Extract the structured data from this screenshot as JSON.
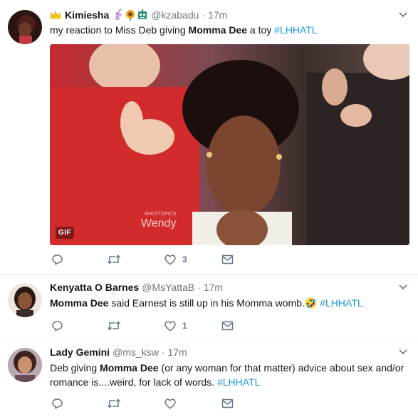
{
  "tweets": [
    {
      "fullname": "Kimiesha",
      "handle": "@kzabadu",
      "dot": "·",
      "time": "17m",
      "text_parts": [
        "my reaction to Miss Deb giving ",
        "Momma Dee",
        " a toy  ",
        "#LHHATL"
      ],
      "media_badge": "GIF",
      "media_watermark_tag": "#HOTTOPICS",
      "media_watermark": "Wendy",
      "reply_count": "",
      "retweet_count": "",
      "like_count": "3"
    },
    {
      "fullname": "Kenyatta O Barnes",
      "handle": "@MsYattaB",
      "dot": "·",
      "time": "17m",
      "text_parts": [
        "Momma Dee",
        " said Earnest  is still up in his Momma womb.",
        "🤣",
        " #LHHATL"
      ],
      "reply_count": "",
      "retweet_count": "",
      "like_count": "1"
    },
    {
      "fullname": "Lady Gemini",
      "handle": "@ms_ksw",
      "dot": "·",
      "time": "17m",
      "text_parts": [
        "Deb giving ",
        "Momma Dee",
        " (or any woman for that matter) advice about sex and/or romance is....weird, for lack of words. ",
        "#LHHATL"
      ],
      "reply_count": "",
      "retweet_count": "",
      "like_count": ""
    }
  ],
  "colors": {
    "text": "#14171a",
    "secondary": "#657786",
    "link": "#1b95e0",
    "divider": "#e6ecf0",
    "gold_emoji": "#f5c518",
    "unicorn_emoji": "#8a5cc7",
    "sunflower_emoji": "#f4a418",
    "robot_emoji": "#2e8b6e"
  },
  "icons": [
    "crown-icon",
    "unicorn-icon",
    "sunflower-icon",
    "robot-icon",
    "caret-down-icon",
    "reply-icon",
    "retweet-icon",
    "heart-icon",
    "direct-message-icon",
    "laughing-emoji"
  ]
}
